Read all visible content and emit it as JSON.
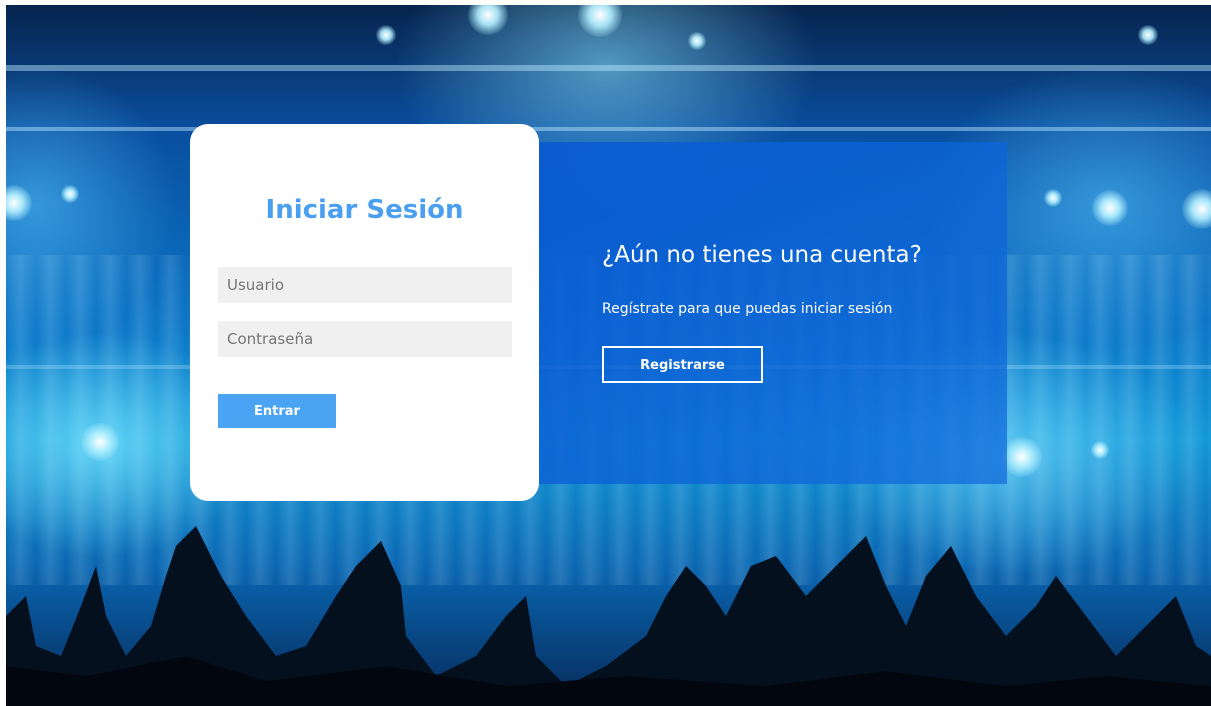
{
  "login": {
    "title": "Iniciar Sesión",
    "username_placeholder": "Usuario",
    "password_placeholder": "Contraseña",
    "submit_label": "Entrar"
  },
  "register": {
    "title": "¿Aún no tienes una cuenta?",
    "text": "Regístrate para que puedas iniciar sesión",
    "button_label": "Registrarse"
  },
  "colors": {
    "accent": "#4a9ff0",
    "button": "#4aa3f3",
    "panel": "#0a5ad2",
    "field_bg": "#f0f0f0"
  }
}
